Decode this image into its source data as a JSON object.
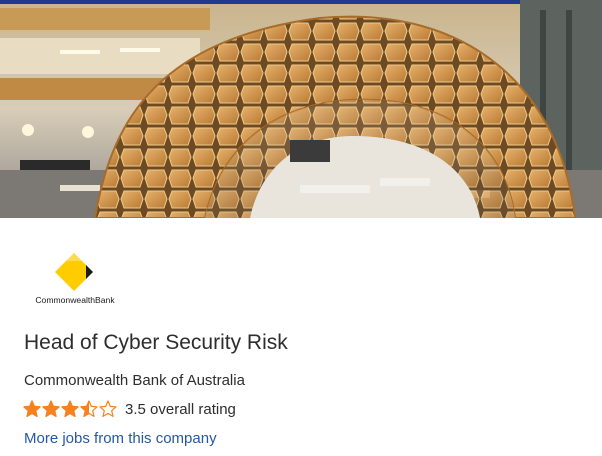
{
  "banner": {
    "icon": "office-atrium-photo"
  },
  "company_logo": {
    "icon": "commbank-diamond-logo",
    "wordmark": "CommonwealthBank",
    "diamond_color": "#ffcc00",
    "edge_color": "#1a1a1a"
  },
  "job": {
    "title": "Head of Cyber Security Risk",
    "company": "Commonwealth Bank of Australia"
  },
  "rating": {
    "value": 3.5,
    "max": 5,
    "text": "3.5 overall rating",
    "star_color": "#f58220"
  },
  "links": {
    "more_jobs": "More jobs from this company"
  },
  "colors": {
    "link": "#2557a7",
    "text": "#2d2d2d"
  }
}
